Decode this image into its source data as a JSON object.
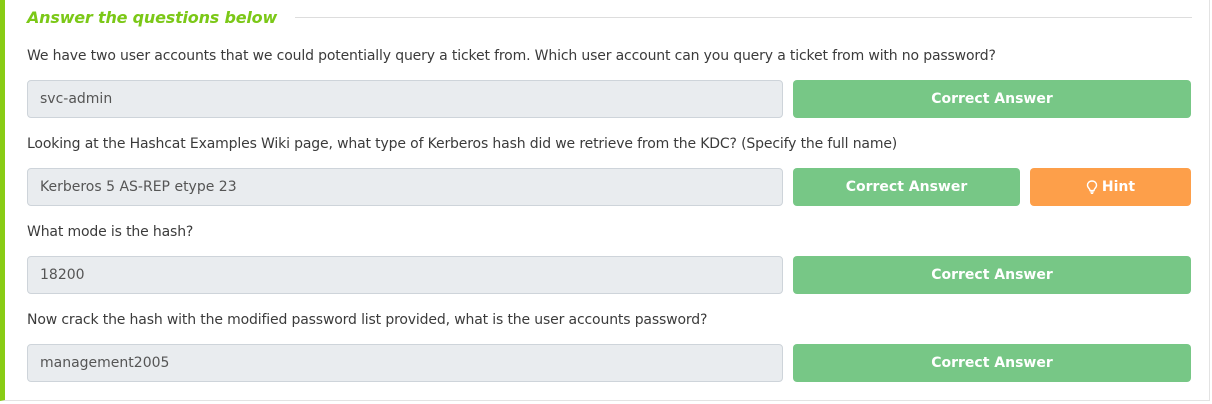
{
  "section": {
    "title": "Answer the questions below"
  },
  "questions": [
    {
      "text": "We have two user accounts that we could potentially query a ticket from. Which user account can you query a ticket from with no password?",
      "answer": "svc-admin",
      "button_label": "Correct Answer"
    },
    {
      "text": "Looking at the Hashcat Examples Wiki page, what type of Kerberos hash did we retrieve from the KDC? (Specify the full name)",
      "answer": "Kerberos 5 AS-REP etype 23",
      "button_label": "Correct Answer",
      "hint_label": "Hint"
    },
    {
      "text": "What mode is the hash?",
      "answer": "18200",
      "button_label": "Correct Answer"
    },
    {
      "text": "Now crack the hash with the modified password list provided, what is the user accounts password?",
      "answer": "management2005",
      "button_label": "Correct Answer"
    }
  ],
  "colors": {
    "accent": "#88cc14",
    "correct": "#77c786",
    "hint": "#fd9f4a"
  }
}
